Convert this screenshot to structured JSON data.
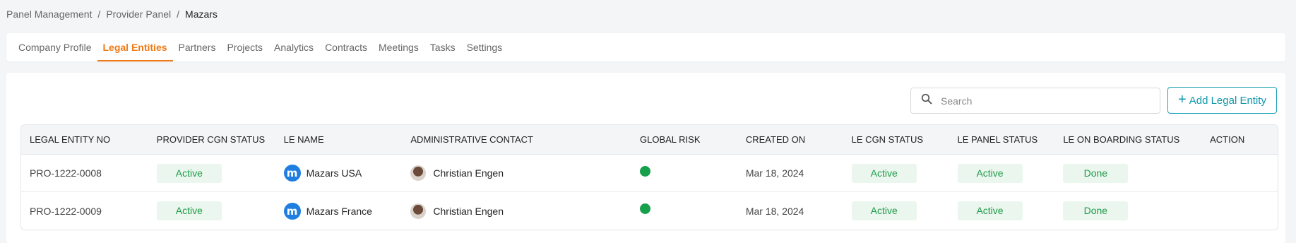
{
  "breadcrumb": {
    "items": [
      "Panel Management",
      "Provider Panel"
    ],
    "current": "Mazars",
    "separator": "/"
  },
  "tabs": [
    {
      "label": "Company Profile",
      "active": false
    },
    {
      "label": "Legal Entities",
      "active": true
    },
    {
      "label": "Partners",
      "active": false
    },
    {
      "label": "Projects",
      "active": false
    },
    {
      "label": "Analytics",
      "active": false
    },
    {
      "label": "Contracts",
      "active": false
    },
    {
      "label": "Meetings",
      "active": false
    },
    {
      "label": "Tasks",
      "active": false
    },
    {
      "label": "Settings",
      "active": false
    }
  ],
  "toolbar": {
    "search_placeholder": "Search",
    "search_icon": "search-icon",
    "add_label": "Add Legal Entity",
    "add_icon": "plus-icon"
  },
  "table": {
    "columns": [
      "LEGAL ENTITY NO",
      "PROVIDER CGN STATUS",
      "LE NAME",
      "ADMINISTRATIVE CONTACT",
      "GLOBAL RISK",
      "CREATED ON",
      "LE CGN STATUS",
      "LE PANEL STATUS",
      "LE ON BOARDING STATUS",
      "ACTION"
    ],
    "rows": [
      {
        "entity_no": "PRO-1222-0008",
        "provider_cgn_status": "Active",
        "le_name": "Mazars USA",
        "le_logo_letter": "m",
        "contact": "Christian Engen",
        "global_risk_color": "#17a04c",
        "created_on": "Mar 18, 2024",
        "le_cgn_status": "Active",
        "le_panel_status": "Active",
        "le_onboarding_status": "Done"
      },
      {
        "entity_no": "PRO-1222-0009",
        "provider_cgn_status": "Active",
        "le_name": "Mazars France",
        "le_logo_letter": "m",
        "contact": "Christian Engen",
        "global_risk_color": "#17a04c",
        "created_on": "Mar 18, 2024",
        "le_cgn_status": "Active",
        "le_panel_status": "Active",
        "le_onboarding_status": "Done"
      }
    ]
  },
  "colors": {
    "accent": "#f07a14",
    "primary_button": "#0e98ab",
    "success_text": "#1e9a47",
    "success_bg": "#ebf7ee"
  }
}
